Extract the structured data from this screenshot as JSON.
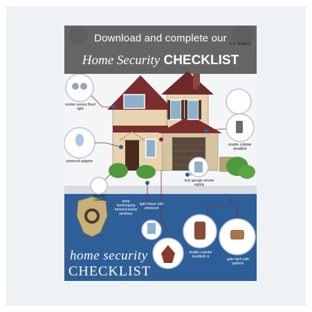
{
  "poster": {
    "header": {
      "line1": "Download and complete our",
      "line2_italic": "Home Security",
      "line2_bold": "CHECKLIST"
    },
    "labels": {
      "motion_sensor": "motion sensor flood light",
      "photocell_adaptor": "photocell adaptor",
      "doorbell_camera": "doorbell camera",
      "double_cylinder_top": "double cylinder deadbolt",
      "lock_garage": "lock garage remote nightly",
      "keep_landscaping": "keep landscaping trimmed below windows",
      "light_fixture": "light fixture with photocell",
      "double_cylinder_bottom": "double cylinder deadbolt or",
      "gate_latch": "gate latch with padlock",
      "top_right_corner": "U.S. deadbolt"
    },
    "footer": {
      "title_line1": "home security",
      "title_line2": "CHECKLIST"
    }
  },
  "colors": {
    "frame_bg": "#eef2f5",
    "header_band": "#3c3c3c",
    "lower_band": "#2f5f98",
    "roof": "#7a2e2e",
    "siding": "#e7d3b0"
  }
}
